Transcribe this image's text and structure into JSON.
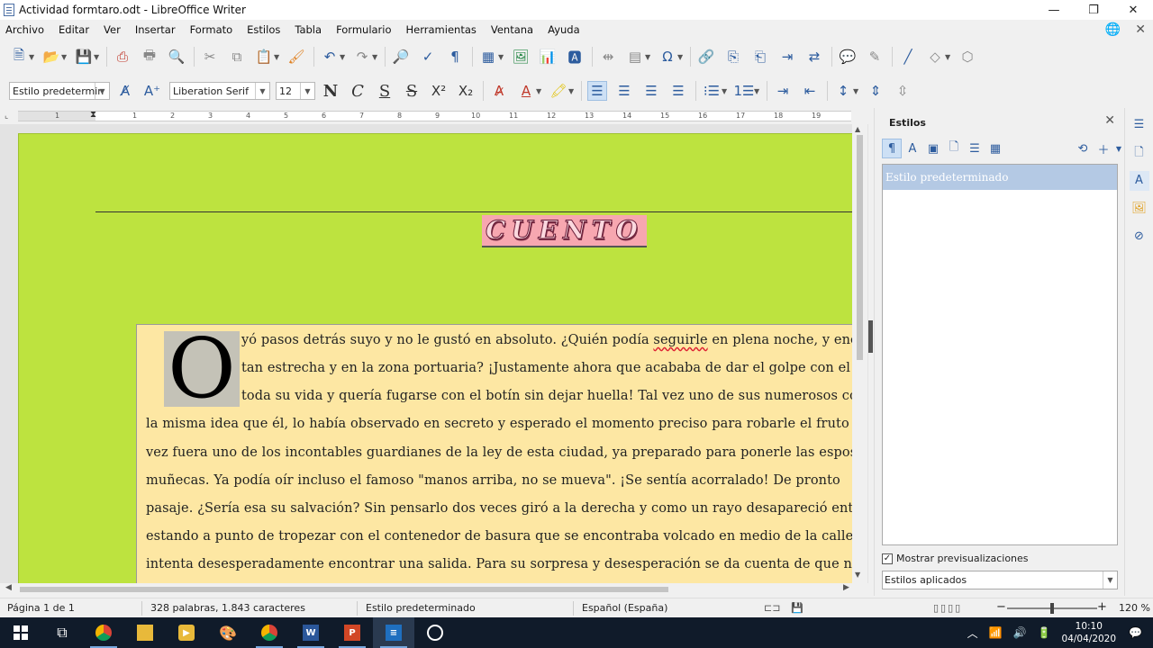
{
  "window": {
    "title": "Actividad formtaro.odt - LibreOffice Writer",
    "minimize": "—",
    "maximize": "❐",
    "close": "✕"
  },
  "menu": [
    "Archivo",
    "Editar",
    "Ver",
    "Insertar",
    "Formato",
    "Estilos",
    "Tabla",
    "Formulario",
    "Herramientas",
    "Ventana",
    "Ayuda"
  ],
  "format_toolbar": {
    "paragraph_style": "Estilo predetermin",
    "font_name": "Liberation Serif",
    "font_size": "12",
    "bold": "N",
    "italic": "C",
    "underline": "S",
    "strike": "S"
  },
  "ruler": {
    "numbers": [
      "1",
      "1",
      "2",
      "3",
      "4",
      "5",
      "6",
      "7",
      "8",
      "9",
      "10",
      "11",
      "12",
      "13",
      "14",
      "15",
      "16",
      "17",
      "18",
      "19"
    ]
  },
  "document": {
    "heading": "CUENTO",
    "drop_cap": "O",
    "lines": [
      {
        "before": "yó pasos detrás suyo y no le gustó en absoluto. ¿Quién podía ",
        "flag": "seguirle",
        "after": " en plena noche, y enci"
      },
      {
        "text": "tan estrecha y en la zona portuaria? ¡Justamente ahora que acababa de dar el golpe con el qu"
      },
      {
        "text": "toda su vida y quería fugarse con el botín sin dejar huella! Tal vez uno de sus numerosos coleg"
      },
      {
        "text": "la misma idea que él, lo había observado en secreto y esperado el momento preciso para robarle el fruto de s"
      },
      {
        "text": "vez fuera uno de los incontables guardianes de la ley de esta ciudad, ya preparado para ponerle las esposas"
      },
      {
        "text": "muñecas. Ya podía oír incluso el famoso  \"manos arriba, no se mueva\". ¡Se sentía acorralado! De pronto"
      },
      {
        "text": "pasaje. ¿Sería esa su salvación? Sin pensarlo dos veces giró a la derecha y como un rayo desapareció entre lo"
      },
      {
        "text": "estando a punto de tropezar con el contenedor de basura que se encontraba volcado en medio de la calle."
      },
      {
        "text": "intenta desesperadamente encontrar una salida. Para su sorpresa y desesperación se da cuenta de que no se pu"
      }
    ]
  },
  "sidebar": {
    "title": "Estilos",
    "styles": [
      "Estilo predeterminado"
    ],
    "show_previews_label": "Mostrar previsualizaciones",
    "show_previews_checked": true,
    "filter": "Estilos aplicados"
  },
  "status": {
    "page": "Página 1 de 1",
    "words": "328 palabras, 1.843 caracteres",
    "style": "Estilo predeterminado",
    "language": "Español (España)",
    "zoom": "120 %",
    "zoom_fraction": 0.5
  },
  "taskbar": {
    "time": "10:10",
    "date": "04/04/2020"
  }
}
